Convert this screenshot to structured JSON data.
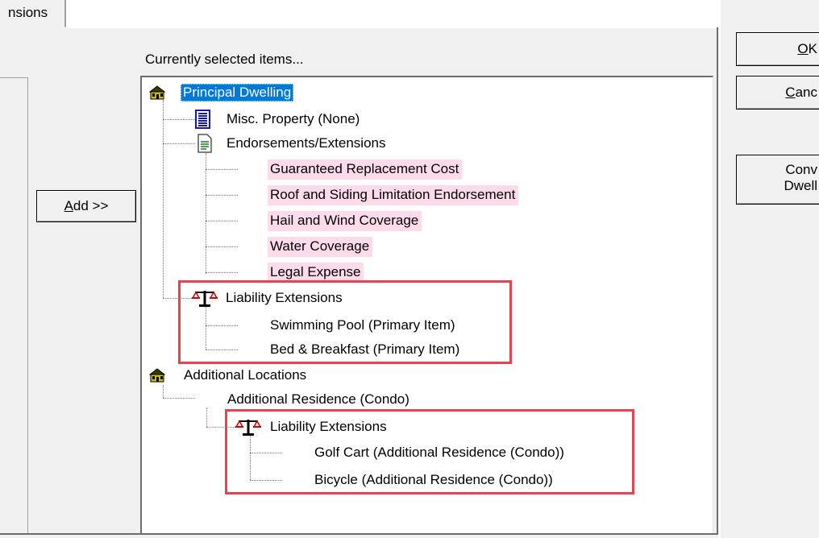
{
  "tab": {
    "label": "nsions"
  },
  "dialog": {
    "caption": "Currently selected items..."
  },
  "buttons": {
    "add": {
      "mnemonic": "A",
      "rest": "dd >>"
    },
    "ok": {
      "mnemonic": "O",
      "rest": "K"
    },
    "cancel": {
      "mnemonic": "C",
      "rest": "anc"
    },
    "convert": {
      "line1": "Conv",
      "line2": "Dwell"
    }
  },
  "tree": {
    "principal": {
      "label": "Principal Dwelling",
      "misc": "Misc. Property (None)",
      "endorsements": {
        "label": "Endorsements/Extensions",
        "items": [
          "Guaranteed Replacement Cost",
          "Roof and Siding Limitation Endorsement",
          "Hail and Wind Coverage",
          "Water Coverage",
          "Legal Expense"
        ]
      },
      "liability": {
        "label": "Liability Extensions",
        "items": [
          "Swimming Pool (Primary Item)",
          "Bed & Breakfast (Primary Item)"
        ]
      }
    },
    "additional": {
      "label": "Additional Locations",
      "residence": "Additional Residence (Condo)",
      "liability": {
        "label": "Liability Extensions",
        "items": [
          "Golf Cart (Additional Residence (Condo))",
          "Bicycle (Additional Residence (Condo))"
        ]
      }
    }
  },
  "colors": {
    "selection": "#0078d7",
    "endorsement_highlight": "#fddbea",
    "annotation_box": "#e8414f"
  },
  "icons": {
    "house": "house-icon",
    "document_list": "document-list-icon",
    "document": "document-icon",
    "scales": "scales-icon"
  }
}
